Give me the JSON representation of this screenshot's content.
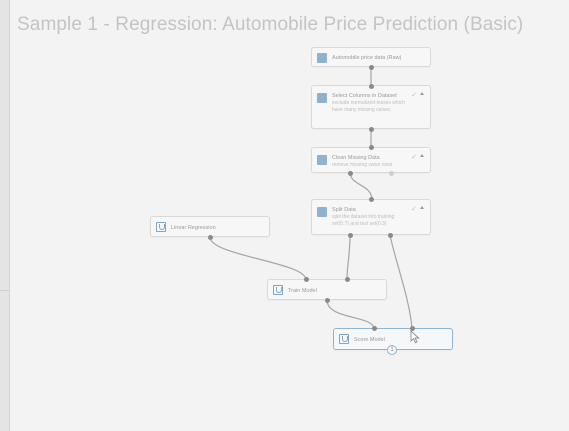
{
  "page": {
    "title": "Sample 1 - Regression: Automobile Price Prediction (Basic)"
  },
  "nodes": {
    "dataset": {
      "name": "Automobile price data (Raw)"
    },
    "select_columns": {
      "name": "Select Columns in Dataset",
      "desc": "exclude normalized-losses which have many missing values"
    },
    "clean_missing": {
      "name": "Clean Missing Data",
      "desc": "remove missing value rows"
    },
    "split": {
      "name": "Split Data",
      "desc": "split the dataset into training set(0.7) and test set(0.3)"
    },
    "linear_regression": {
      "name": "Linear Regression"
    },
    "train_model": {
      "name": "Train Model"
    },
    "score_model": {
      "name": "Score Model",
      "badge": "1"
    }
  },
  "icons": {
    "dataset": "database-icon",
    "transform": "transform-module-icon",
    "model": "model-module-icon",
    "status_ok": "check-icon"
  },
  "colors": {
    "selected_border": "#8fb4d0",
    "check": "#9fd19b",
    "connector": "#9a9a9a"
  }
}
